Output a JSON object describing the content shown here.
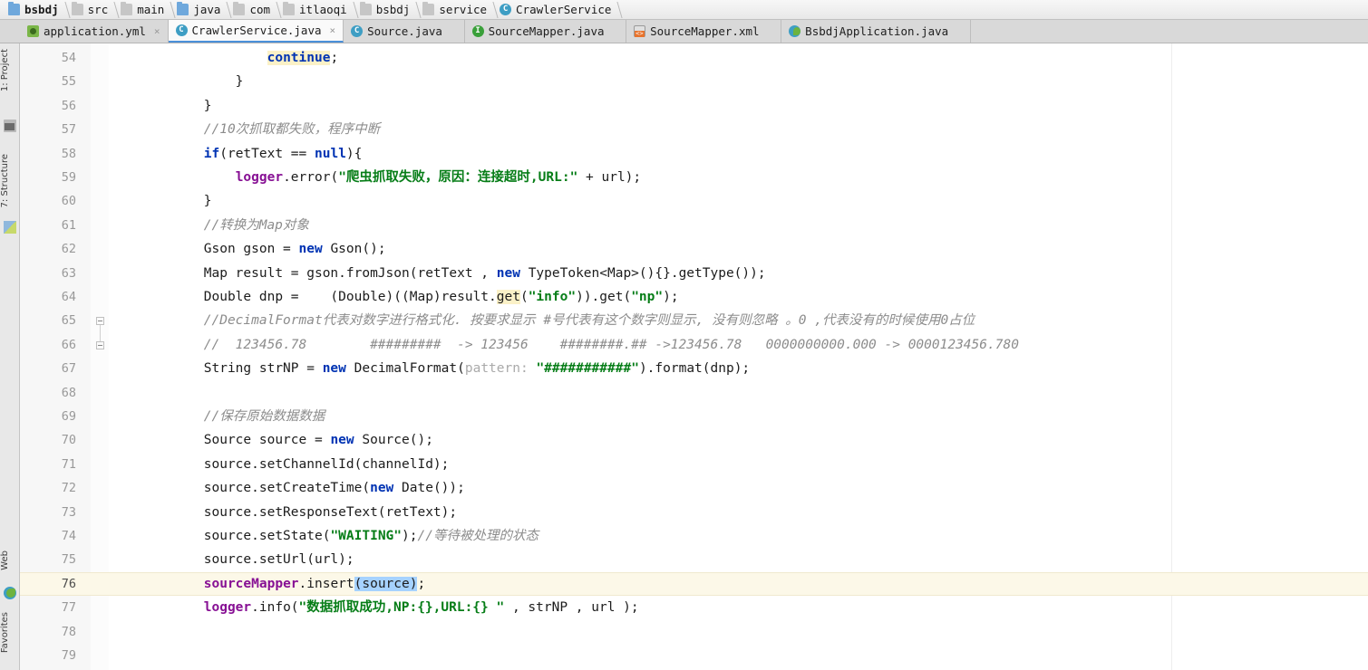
{
  "breadcrumb": {
    "items": [
      {
        "label": "bsbdj",
        "icon": "folder-module-icon",
        "kind": "folder-blue"
      },
      {
        "label": "src",
        "icon": "folder-icon",
        "kind": "folder-grey"
      },
      {
        "label": "main",
        "icon": "folder-icon",
        "kind": "folder-grey"
      },
      {
        "label": "java",
        "icon": "folder-source-icon",
        "kind": "folder-blue"
      },
      {
        "label": "com",
        "icon": "folder-icon",
        "kind": "folder-grey"
      },
      {
        "label": "itlaoqi",
        "icon": "folder-icon",
        "kind": "folder-grey"
      },
      {
        "label": "bsbdj",
        "icon": "folder-icon",
        "kind": "folder-grey"
      },
      {
        "label": "service",
        "icon": "folder-icon",
        "kind": "folder-grey"
      },
      {
        "label": "CrawlerService",
        "icon": "java-class-icon",
        "kind": "class",
        "glyph": "C"
      }
    ]
  },
  "tabs": {
    "items": [
      {
        "label": "application.yml",
        "icon": "yaml-file-icon",
        "kind": "yml",
        "active": false,
        "closable": true
      },
      {
        "label": "CrawlerService.java",
        "icon": "java-class-icon",
        "kind": "class",
        "glyph": "C",
        "active": true,
        "closable": true,
        "close_glyph": "×"
      },
      {
        "label": "Source.java",
        "icon": "java-class-icon",
        "kind": "class",
        "glyph": "C",
        "active": false,
        "closable": false
      },
      {
        "label": "SourceMapper.java",
        "icon": "java-interface-icon",
        "kind": "iface",
        "glyph": "I",
        "active": false,
        "closable": false
      },
      {
        "label": "SourceMapper.xml",
        "icon": "xml-file-icon",
        "kind": "xml",
        "active": false,
        "closable": false
      },
      {
        "label": "BsbdjApplication.java",
        "icon": "spring-boot-class-icon",
        "kind": "spring",
        "active": false,
        "closable": false
      }
    ]
  },
  "left_tool_window": {
    "items": [
      {
        "label": "1: Project",
        "icon": "project-tool-icon"
      },
      {
        "label": "7: Structure",
        "icon": "structure-tool-icon"
      },
      {
        "label": "Web",
        "icon": "web-tool-icon"
      },
      {
        "label": "Favorites",
        "icon": "favorites-tool-icon"
      }
    ]
  },
  "editor": {
    "file": "CrawlerService.java",
    "current_line": 76,
    "first_visible_line": 54,
    "last_visible_line": 79,
    "colors": {
      "keyword": "#0033b3",
      "string": "#067d17",
      "comment": "#8c8c8c",
      "field": "#871094",
      "caret_row": "#fcf8e8",
      "selection": "#a6d2ff",
      "identifier_highlight": "#fbf1c7",
      "accent": "#4a90d9"
    },
    "fold_markers": [
      65,
      66
    ],
    "lines": [
      {
        "n": 54,
        "highlight": "search",
        "tokens": [
          {
            "t": "                    ",
            "c": "plain"
          },
          {
            "t": "continue",
            "c": "kw mark"
          },
          {
            "t": ";",
            "c": "plain"
          }
        ]
      },
      {
        "n": 55,
        "tokens": [
          {
            "t": "                }",
            "c": "plain"
          }
        ]
      },
      {
        "n": 56,
        "tokens": [
          {
            "t": "            }",
            "c": "plain"
          }
        ]
      },
      {
        "n": 57,
        "tokens": [
          {
            "t": "            //10次抓取都失败，程序中断",
            "c": "cm"
          }
        ]
      },
      {
        "n": 58,
        "tokens": [
          {
            "t": "            ",
            "c": "plain"
          },
          {
            "t": "if",
            "c": "kw"
          },
          {
            "t": "(retText == ",
            "c": "plain"
          },
          {
            "t": "null",
            "c": "kw"
          },
          {
            "t": "){",
            "c": "plain"
          }
        ]
      },
      {
        "n": 59,
        "tokens": [
          {
            "t": "                ",
            "c": "plain"
          },
          {
            "t": "logger",
            "c": "fld"
          },
          {
            "t": ".error(",
            "c": "plain"
          },
          {
            "t": "\"爬虫抓取失败，原因：连接超时,URL:\"",
            "c": "str"
          },
          {
            "t": " + url);",
            "c": "plain"
          }
        ]
      },
      {
        "n": 60,
        "tokens": [
          {
            "t": "            }",
            "c": "plain"
          }
        ]
      },
      {
        "n": 61,
        "tokens": [
          {
            "t": "            //转换为Map对象",
            "c": "cm"
          }
        ]
      },
      {
        "n": 62,
        "tokens": [
          {
            "t": "            Gson gson = ",
            "c": "plain"
          },
          {
            "t": "new",
            "c": "kw"
          },
          {
            "t": " Gson();",
            "c": "plain"
          }
        ]
      },
      {
        "n": 63,
        "tokens": [
          {
            "t": "            Map result = gson.fromJson(retText , ",
            "c": "plain"
          },
          {
            "t": "new",
            "c": "kw"
          },
          {
            "t": " TypeToken<Map>(){}.getType());",
            "c": "plain"
          }
        ]
      },
      {
        "n": 64,
        "tokens": [
          {
            "t": "            Double dnp =    (Double)((Map)result.",
            "c": "plain"
          },
          {
            "t": "get",
            "c": "plain mark"
          },
          {
            "t": "(",
            "c": "plain"
          },
          {
            "t": "\"info\"",
            "c": "str"
          },
          {
            "t": ")).get(",
            "c": "plain"
          },
          {
            "t": "\"np\"",
            "c": "str"
          },
          {
            "t": ");",
            "c": "plain"
          }
        ]
      },
      {
        "n": 65,
        "tokens": [
          {
            "t": "            //DecimalFormat代表对数字进行格式化. 按要求显示 #号代表有这个数字则显示, 没有则忽略 。0 ,代表没有的时候使用0占位",
            "c": "cm"
          }
        ]
      },
      {
        "n": 66,
        "tokens": [
          {
            "t": "            //  123456.78        #########  -> 123456    ########.## ->123456.78   0000000000.000 -> 0000123456.780",
            "c": "cm"
          }
        ]
      },
      {
        "n": 67,
        "tokens": [
          {
            "t": "            String strNP = ",
            "c": "plain"
          },
          {
            "t": "new",
            "c": "kw"
          },
          {
            "t": " DecimalFormat(",
            "c": "plain"
          },
          {
            "t": "pattern:",
            "c": "hint"
          },
          {
            "t": " ",
            "c": "plain"
          },
          {
            "t": "\"###########\"",
            "c": "str"
          },
          {
            "t": ").format(dnp);",
            "c": "plain"
          }
        ]
      },
      {
        "n": 68,
        "tokens": [
          {
            "t": "",
            "c": "plain"
          }
        ]
      },
      {
        "n": 69,
        "tokens": [
          {
            "t": "            //保存原始数据数据",
            "c": "cm"
          }
        ]
      },
      {
        "n": 70,
        "tokens": [
          {
            "t": "            Source source = ",
            "c": "plain"
          },
          {
            "t": "new",
            "c": "kw"
          },
          {
            "t": " Source();",
            "c": "plain"
          }
        ]
      },
      {
        "n": 71,
        "tokens": [
          {
            "t": "            source.setChannelId(channelId);",
            "c": "plain"
          }
        ]
      },
      {
        "n": 72,
        "tokens": [
          {
            "t": "            source.setCreateTime(",
            "c": "plain"
          },
          {
            "t": "new",
            "c": "kw"
          },
          {
            "t": " Date());",
            "c": "plain"
          }
        ]
      },
      {
        "n": 73,
        "tokens": [
          {
            "t": "            source.setResponseText(retText);",
            "c": "plain"
          }
        ]
      },
      {
        "n": 74,
        "tokens": [
          {
            "t": "            source.setState(",
            "c": "plain"
          },
          {
            "t": "\"WAITING\"",
            "c": "str"
          },
          {
            "t": ");",
            "c": "plain"
          },
          {
            "t": "//等待被处理的状态",
            "c": "cm"
          }
        ]
      },
      {
        "n": 75,
        "tokens": [
          {
            "t": "            source.setUrl(url);",
            "c": "plain"
          }
        ]
      },
      {
        "n": 76,
        "highlight": "caret",
        "tokens": [
          {
            "t": "            ",
            "c": "plain"
          },
          {
            "t": "sourceMapper",
            "c": "fld"
          },
          {
            "t": ".insert",
            "c": "plain"
          },
          {
            "t": "(source)",
            "c": "plain sel"
          },
          {
            "t": ";",
            "c": "plain"
          }
        ]
      },
      {
        "n": 77,
        "tokens": [
          {
            "t": "            ",
            "c": "plain"
          },
          {
            "t": "logger",
            "c": "fld"
          },
          {
            "t": ".info(",
            "c": "plain"
          },
          {
            "t": "\"数据抓取成功,NP:{},URL:{} \"",
            "c": "str"
          },
          {
            "t": " , strNP , url );",
            "c": "plain"
          }
        ]
      },
      {
        "n": 78,
        "tokens": [
          {
            "t": "",
            "c": "plain"
          }
        ]
      },
      {
        "n": 79,
        "tokens": [
          {
            "t": "",
            "c": "plain"
          }
        ]
      }
    ]
  }
}
